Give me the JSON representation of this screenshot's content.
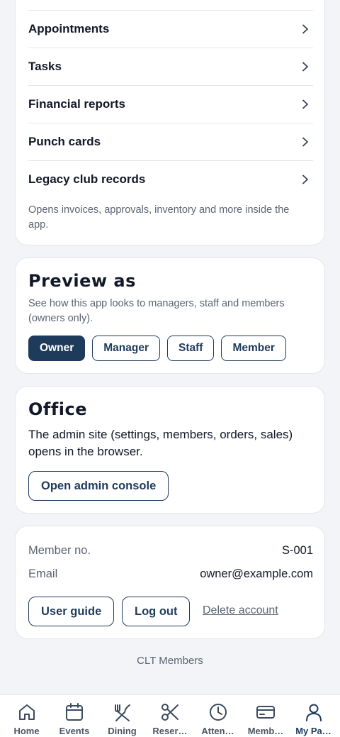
{
  "menu": {
    "items": [
      {
        "label": "Appointments"
      },
      {
        "label": "Tasks"
      },
      {
        "label": "Financial reports"
      },
      {
        "label": "Punch cards"
      },
      {
        "label": "Legacy club records"
      }
    ],
    "note": "Opens invoices, approvals, inventory and more inside the app."
  },
  "preview": {
    "title": "Preview as",
    "subtitle": "See how this app looks to managers, staff and members (owners only).",
    "roles": [
      {
        "label": "Owner",
        "active": true
      },
      {
        "label": "Manager",
        "active": false
      },
      {
        "label": "Staff",
        "active": false
      },
      {
        "label": "Member",
        "active": false
      }
    ]
  },
  "office": {
    "title": "Office",
    "text": "The admin site (settings, members, orders, sales) opens in the browser.",
    "button_label": "Open admin console"
  },
  "member": {
    "number_label": "Member no.",
    "number_value": "S-001",
    "email_label": "Email",
    "email_value": "owner@example.com",
    "user_guide_label": "User guide",
    "logout_label": "Log out",
    "delete_label": "Delete account"
  },
  "footer": {
    "brand": "CLT Members"
  },
  "nav": {
    "items": [
      {
        "label": "Home",
        "icon": "home-icon"
      },
      {
        "label": "Events",
        "icon": "calendar-icon"
      },
      {
        "label": "Dining",
        "icon": "utensils-icon"
      },
      {
        "label": "Reser…",
        "icon": "scissors-icon"
      },
      {
        "label": "Atten…",
        "icon": "clock-icon"
      },
      {
        "label": "Memb…",
        "icon": "card-icon"
      },
      {
        "label": "My Pa…",
        "icon": "user-icon",
        "active": true
      }
    ]
  },
  "colors": {
    "primary": "#1f3b5c",
    "muted": "#5b6472",
    "background": "#f2f4f7"
  }
}
